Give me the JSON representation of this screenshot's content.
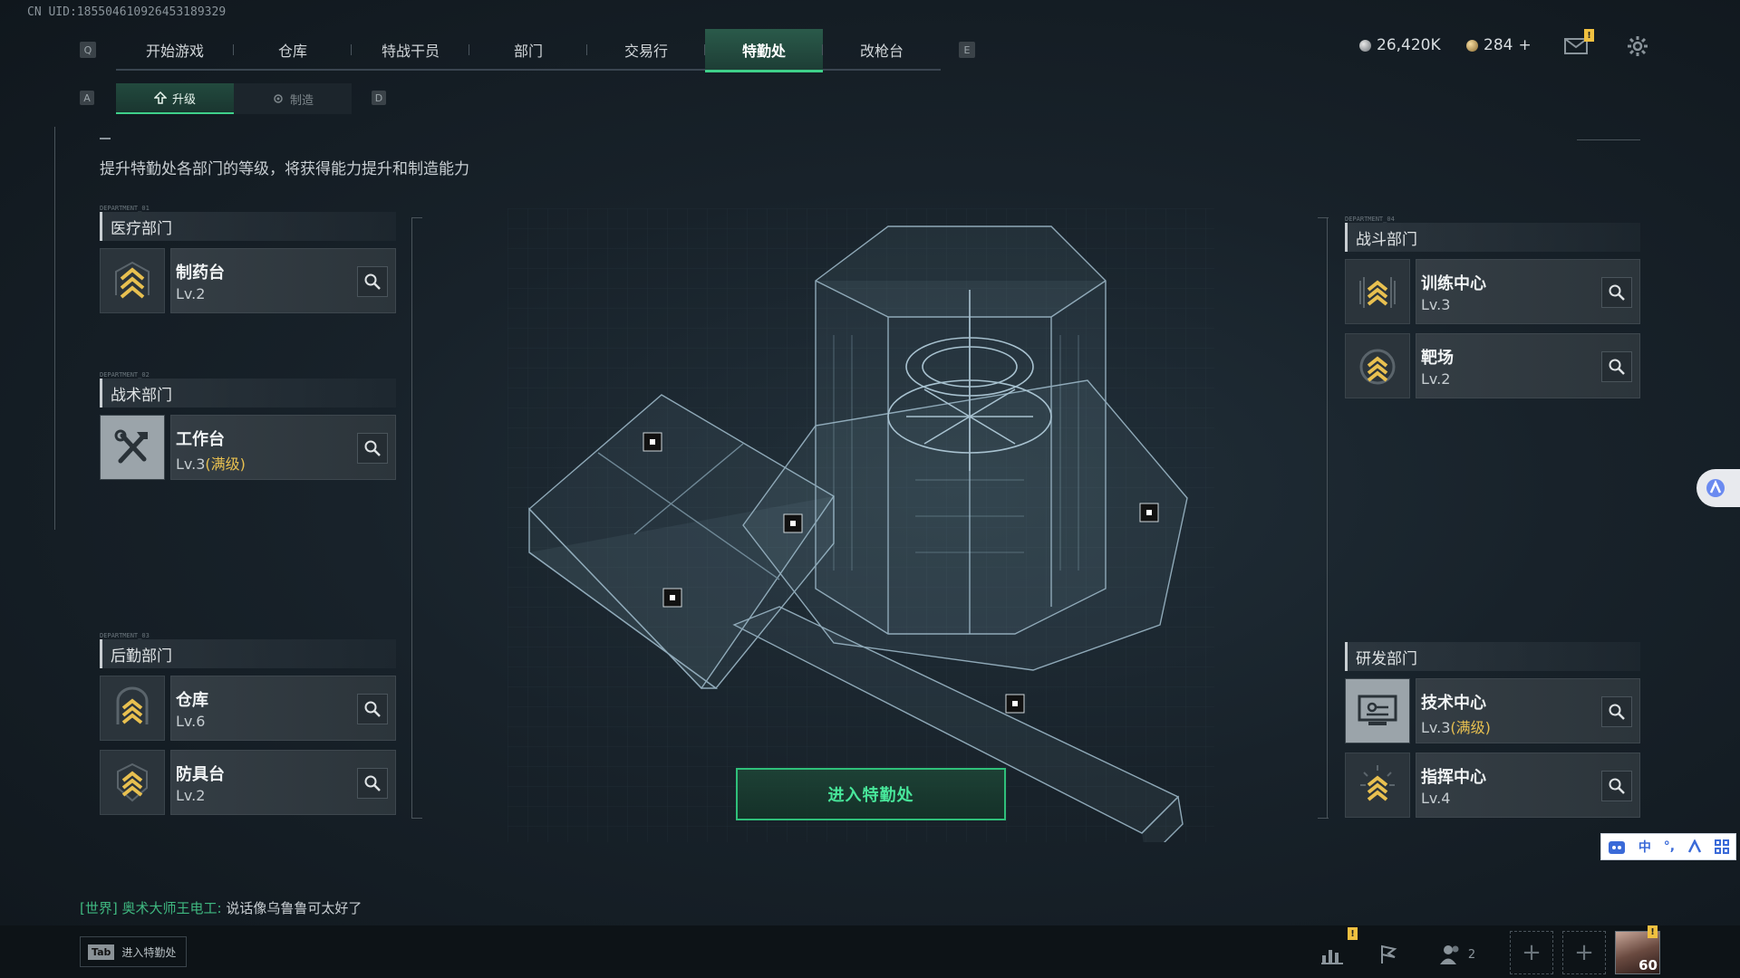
{
  "uid": "CN UID:1855046109264531893​29",
  "nav": {
    "left_key": "Q",
    "right_key": "E",
    "tabs": [
      {
        "label": "开始游戏"
      },
      {
        "label": "仓库"
      },
      {
        "label": "特战干员"
      },
      {
        "label": "部门"
      },
      {
        "label": "交易行"
      },
      {
        "label": "特勤处",
        "active": true
      },
      {
        "label": "改枪台"
      }
    ]
  },
  "currency": {
    "silver": "26,420K",
    "gold": "284",
    "gold_add": "+"
  },
  "alerts": {
    "mail": "!",
    "stats": "!",
    "avatar": "!"
  },
  "subtabs": {
    "left_key": "A",
    "right_key": "D",
    "upgrade": "升级",
    "craft": "制造"
  },
  "description": "提升特勤处各部门的等级，将获得能力提升和制造能力",
  "departments": {
    "medical": {
      "tag": "DEPARTMENT_01",
      "title": "医疗部门",
      "items": [
        {
          "name": "制药台",
          "level": "Lv.2"
        }
      ]
    },
    "tactical": {
      "tag": "DEPARTMENT_02",
      "title": "战术部门",
      "items": [
        {
          "name": "工作台",
          "level": "Lv.3",
          "max": "(满级)"
        }
      ]
    },
    "logistics": {
      "tag": "DEPARTMENT_03",
      "title": "后勤部门",
      "items": [
        {
          "name": "仓库",
          "level": "Lv.6"
        },
        {
          "name": "防具台",
          "level": "Lv.2"
        }
      ]
    },
    "combat": {
      "tag": "DEPARTMENT_04",
      "title": "战斗部门",
      "items": [
        {
          "name": "训练中心",
          "level": "Lv.3"
        },
        {
          "name": "靶场",
          "level": "Lv.2"
        }
      ]
    },
    "research": {
      "title": "研发部门",
      "items": [
        {
          "name": "技术中心",
          "level": "Lv.3",
          "max": "(满级)"
        },
        {
          "name": "指挥中心",
          "level": "Lv.4"
        }
      ]
    }
  },
  "enter_button": "进入特勤处",
  "chat": {
    "channel": "[世界]",
    "name": "奥术大师王电工:",
    "message": "说话像乌鲁鲁可太好了"
  },
  "tab_hint": {
    "key": "Tab",
    "label": "进入特勤处"
  },
  "friends_count": "2",
  "avatar_level": "60",
  "ime": {
    "lang": "中",
    "punct": "°,"
  },
  "colors": {
    "accent": "#3fd08a",
    "max_level": "#e8c050",
    "background": "#18222a"
  }
}
